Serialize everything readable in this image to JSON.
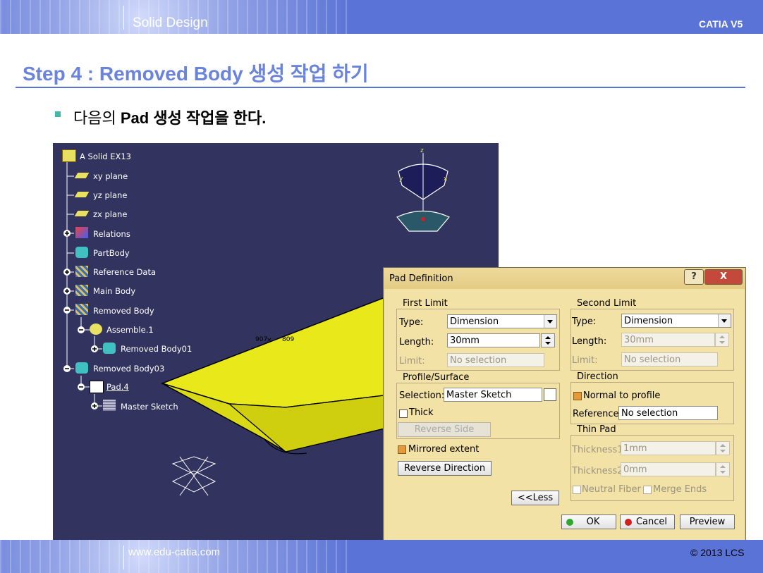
{
  "header": {
    "section": "Solid Design",
    "brand": "CATIA V5"
  },
  "footer": {
    "website": "www.edu-catia.com",
    "copyright": "© 2013 LCS"
  },
  "slide": {
    "title": "Step 4 : Removed Body 생성 작업 하기",
    "bullet_pre": "다음의 ",
    "bullet_bold": "Pad",
    "bullet_post": " 생성 작업을 한다."
  },
  "tree": {
    "root": "A Solid EX13",
    "items": [
      "xy plane",
      "yz plane",
      "zx plane",
      "Relations",
      "PartBody",
      "Reference Data",
      "Main Body",
      "Removed Body",
      "Assemble.1",
      "Removed Body01",
      "Removed Body03",
      "Pad.4",
      "Master Sketch"
    ]
  },
  "viewport": {
    "coord_x": "907",
    "coord_y": "809",
    "axis_z": "z",
    "axis_y": "y",
    "axis_x": "x"
  },
  "dialog": {
    "title": "Pad Definition",
    "help_glyph": "?",
    "close_glyph": "X",
    "first_limit": {
      "label": "First Limit",
      "type_label": "Type:",
      "type_value": "Dimension",
      "length_label": "Length:",
      "length_value": "30mm",
      "limit_label": "Limit:",
      "limit_value": "No selection"
    },
    "profile": {
      "label": "Profile/Surface",
      "selection_label": "Selection:",
      "selection_value": "Master Sketch",
      "thick_label": "Thick",
      "reverse_side": "Reverse Side"
    },
    "mirrored_extent": "Mirrored extent",
    "reverse_direction": "Reverse Direction",
    "less_button": "<<Less",
    "second_limit": {
      "label": "Second Limit",
      "type_label": "Type:",
      "type_value": "Dimension",
      "length_label": "Length:",
      "length_value": "30mm",
      "limit_label": "Limit:",
      "limit_value": "No selection"
    },
    "direction": {
      "label": "Direction",
      "normal_label": "Normal to profile",
      "reference_label": "Reference:",
      "reference_value": "No selection"
    },
    "thin_pad": {
      "label": "Thin Pad",
      "thickness1_label": "Thickness1:",
      "thickness1_value": "1mm",
      "thickness2_label": "Thickness2:",
      "thickness2_value": "0mm",
      "neutral_fiber": "Neutral Fiber",
      "merge_ends": "Merge Ends"
    },
    "ok": "OK",
    "cancel": "Cancel",
    "preview": "Preview"
  },
  "colors": {
    "band": "#5a73d6",
    "title": "#6a84dd",
    "viewport_bg": "#33335f",
    "solid_face": "#e8e81a",
    "dialog_bg": "#f3e2a6"
  }
}
